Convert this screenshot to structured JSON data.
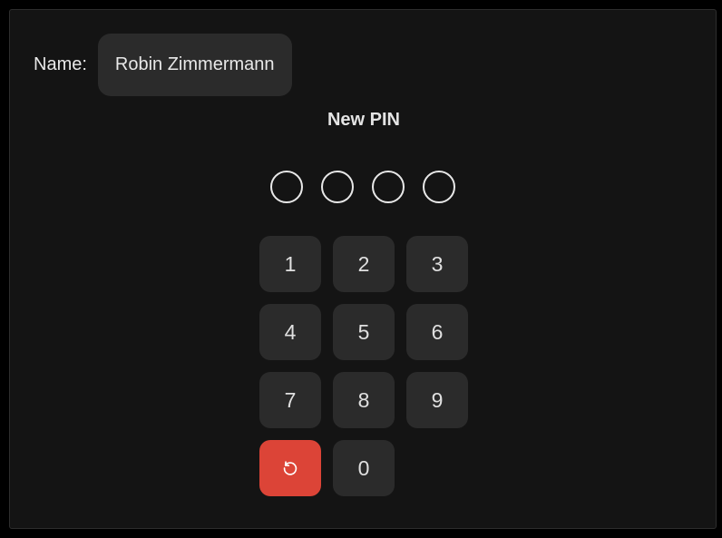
{
  "form": {
    "name_label": "Name:",
    "name_value": "Robin Zimmermann"
  },
  "pin": {
    "title": "New PIN",
    "length": 4,
    "entered": 0
  },
  "keypad": {
    "keys": [
      "1",
      "2",
      "3",
      "4",
      "5",
      "6",
      "7",
      "8",
      "9"
    ],
    "zero": "0",
    "reset_icon": "reset-icon",
    "reset_color": "#dc4437"
  },
  "colors": {
    "background": "#141414",
    "key": "#2b2b2b",
    "text": "#e0e0e0"
  }
}
